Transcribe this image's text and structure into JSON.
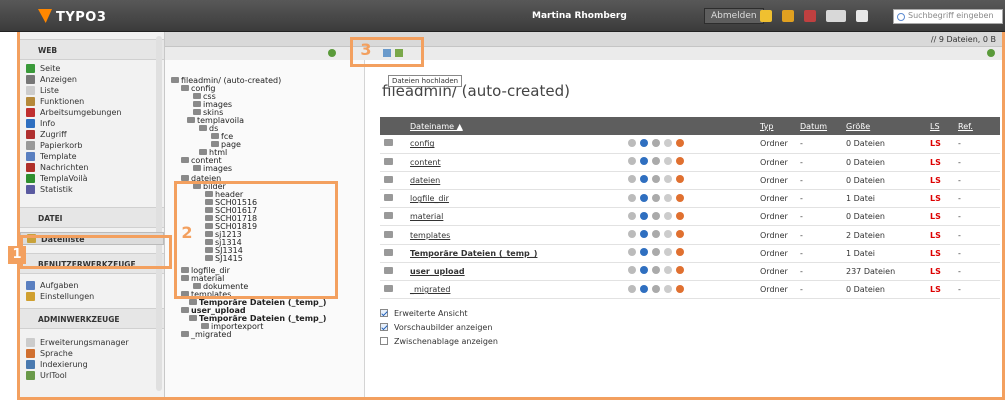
{
  "app": {
    "brand": "TYPO3"
  },
  "topbar": {
    "user": "Martina Rhomberg",
    "logout": "Abmelden",
    "search_placeholder": "Suchbegriff eingeben",
    "icons": [
      "star-icon",
      "flash-icon",
      "clear-cache-icon",
      "workspace-icon",
      "help-icon"
    ]
  },
  "menu": {
    "web_header": "WEB",
    "web_items": [
      {
        "label": "Seite",
        "icon": "page-icon",
        "color": "#3a9a3a"
      },
      {
        "label": "Anzeigen",
        "icon": "view-icon",
        "color": "#777777"
      },
      {
        "label": "Liste",
        "icon": "list-icon",
        "color": "#cccccc"
      },
      {
        "label": "Funktionen",
        "icon": "functions-icon",
        "color": "#b5893a"
      },
      {
        "label": "Arbeitsumgebungen",
        "icon": "workspace-icon",
        "color": "#c03030"
      },
      {
        "label": "Info",
        "icon": "info-icon",
        "color": "#2f6fc0"
      },
      {
        "label": "Zugriff",
        "icon": "access-icon",
        "color": "#b03030"
      },
      {
        "label": "Papierkorb",
        "icon": "recycler-icon",
        "color": "#999999"
      },
      {
        "label": "Template",
        "icon": "template-icon",
        "color": "#5a7fc0"
      },
      {
        "label": "Nachrichten",
        "icon": "news-icon",
        "color": "#b0302a"
      },
      {
        "label": "TemplaVoilà",
        "icon": "templavoila-icon",
        "color": "#2f8f2f"
      },
      {
        "label": "Statistik",
        "icon": "statistics-icon",
        "color": "#5a5aa0"
      }
    ],
    "file_header": "DATEI",
    "file_items": [
      {
        "label": "Dateiliste",
        "icon": "filelist-icon",
        "color": "#c8a23a"
      }
    ],
    "user_header": "BENUTZERWERKZEUGE",
    "user_items": [
      {
        "label": "Aufgaben",
        "icon": "tasks-icon",
        "color": "#5a7fc0"
      },
      {
        "label": "Einstellungen",
        "icon": "settings-icon",
        "color": "#d0a030"
      }
    ],
    "admin_header": "ADMINWERKZEUGE",
    "admin_items": [
      {
        "label": "Erweiterungsmanager",
        "icon": "extension-icon",
        "color": "#cccccc"
      },
      {
        "label": "Sprache",
        "icon": "language-icon",
        "color": "#d07030"
      },
      {
        "label": "Indexierung",
        "icon": "indexing-icon",
        "color": "#4a7ab0"
      },
      {
        "label": "UrlTool",
        "icon": "urltool-icon",
        "color": "#6a9a4a"
      }
    ]
  },
  "badges": {
    "one": "1",
    "two": "2",
    "three": "3"
  },
  "docheader": {
    "count": "// 9 Dateien, 0 B"
  },
  "tooltip": "Dateien hochladen",
  "tree": [
    {
      "label": "fileadmin/ (auto-created)",
      "bold": false
    },
    {
      "label": "config",
      "bold": false
    },
    {
      "label": "css",
      "bold": false
    },
    {
      "label": "images",
      "bold": false
    },
    {
      "label": "skins",
      "bold": false
    },
    {
      "label": "templavoila",
      "bold": false
    },
    {
      "label": "ds",
      "bold": false
    },
    {
      "label": "fce",
      "bold": false
    },
    {
      "label": "page",
      "bold": false
    },
    {
      "label": "html",
      "bold": false
    },
    {
      "label": "content",
      "bold": false
    },
    {
      "label": "images",
      "bold": false
    },
    {
      "label": "dateien",
      "bold": false
    },
    {
      "label": "bilder",
      "bold": false
    },
    {
      "label": "header",
      "bold": false
    },
    {
      "label": "SCH01516",
      "bold": false
    },
    {
      "label": "SCH01617",
      "bold": false
    },
    {
      "label": "SCH01718",
      "bold": false
    },
    {
      "label": "SCH01819",
      "bold": false
    },
    {
      "label": "sj1213",
      "bold": false
    },
    {
      "label": "sj1314",
      "bold": false
    },
    {
      "label": "SJ1314",
      "bold": false
    },
    {
      "label": "SJ1415",
      "bold": false
    },
    {
      "label": "logfile_dir",
      "bold": false
    },
    {
      "label": "material",
      "bold": false
    },
    {
      "label": "dokumente",
      "bold": false
    },
    {
      "label": "templates",
      "bold": false
    },
    {
      "label": "Temporäre Dateien (_temp_)",
      "bold": true
    },
    {
      "label": "user_upload",
      "bold": true
    },
    {
      "label": "Temporäre Dateien (_temp_)",
      "bold": true
    },
    {
      "label": "importexport",
      "bold": false
    },
    {
      "label": "_migrated",
      "bold": false
    }
  ],
  "main": {
    "title": "fileadmin/ (auto-created)",
    "columns": [
      "Dateiname ▲",
      "Typ",
      "Datum",
      "Größe",
      "LS",
      "Ref."
    ],
    "rows": [
      {
        "name": "config",
        "type": "Ordner",
        "date": "-",
        "size": "0 Dateien",
        "ls": "LS",
        "ref": "-",
        "bold": false
      },
      {
        "name": "content",
        "type": "Ordner",
        "date": "-",
        "size": "0 Dateien",
        "ls": "LS",
        "ref": "-",
        "bold": false
      },
      {
        "name": "dateien",
        "type": "Ordner",
        "date": "-",
        "size": "0 Dateien",
        "ls": "LS",
        "ref": "-",
        "bold": false
      },
      {
        "name": "logfile_dir",
        "type": "Ordner",
        "date": "-",
        "size": "1 Datei",
        "ls": "LS",
        "ref": "-",
        "bold": false
      },
      {
        "name": "material",
        "type": "Ordner",
        "date": "-",
        "size": "0 Dateien",
        "ls": "LS",
        "ref": "-",
        "bold": false
      },
      {
        "name": "templates",
        "type": "Ordner",
        "date": "-",
        "size": "2 Dateien",
        "ls": "LS",
        "ref": "-",
        "bold": false
      },
      {
        "name": "Temporäre Dateien (_temp_)",
        "type": "Ordner",
        "date": "-",
        "size": "1 Datei",
        "ls": "LS",
        "ref": "-",
        "bold": true
      },
      {
        "name": "user_upload",
        "type": "Ordner",
        "date": "-",
        "size": "237 Dateien",
        "ls": "LS",
        "ref": "-",
        "bold": true
      },
      {
        "name": "_migrated",
        "type": "Ordner",
        "date": "-",
        "size": "0 Dateien",
        "ls": "LS",
        "ref": "-",
        "bold": false
      }
    ],
    "options": [
      {
        "label": "Erweiterte Ansicht",
        "checked": true
      },
      {
        "label": "Vorschaubilder anzeigen",
        "checked": true
      },
      {
        "label": "Zwischenablage anzeigen",
        "checked": false
      }
    ]
  },
  "colors": {
    "accent": "#f3a05f",
    "header_dark": "#5e5e5e",
    "ls_red": "#dd0000"
  }
}
